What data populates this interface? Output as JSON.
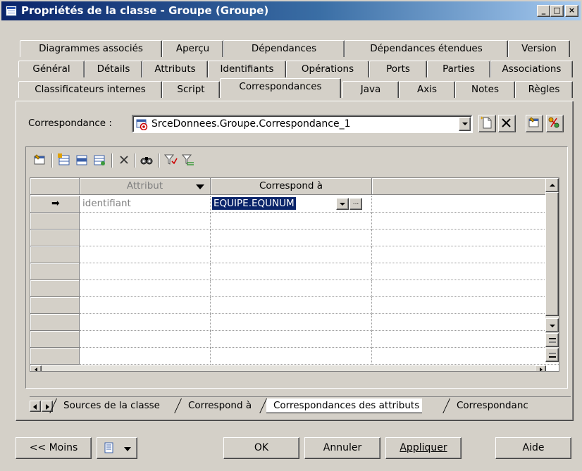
{
  "window": {
    "title": "Propriétés de la classe - Groupe (Groupe)",
    "controls": {
      "minimize": "_",
      "maximize": "□",
      "close": "×"
    }
  },
  "tabs": {
    "row1": [
      "Diagrammes associés",
      "Aperçu",
      "Dépendances",
      "Dépendances étendues",
      "Version"
    ],
    "row2": [
      "Général",
      "Détails",
      "Attributs",
      "Identifiants",
      "Opérations",
      "Ports",
      "Parties",
      "Associations"
    ],
    "row3": [
      "Classificateurs internes",
      "Script",
      "Correspondances",
      "Java",
      "Axis",
      "Notes",
      "Règles"
    ],
    "active": "Correspondances"
  },
  "mapping": {
    "label": "Correspondance :",
    "selected": "SrceDonnees.Groupe.Correspondance_1"
  },
  "grid": {
    "columns": [
      "Attribut",
      "Correspond à"
    ],
    "rows": [
      {
        "attribute": "identifiant",
        "maps_to": "EQUIPE.EQUNUM",
        "current": true
      }
    ],
    "ellipsis": "..."
  },
  "sheet_tabs": [
    "Sources de la classe",
    "Correspond à",
    "Correspondances des attributs",
    "Correspondanc"
  ],
  "active_sheet": "Correspondances des attributs",
  "buttons": {
    "less": "<< Moins",
    "ok": "OK",
    "cancel": "Annuler",
    "apply": "Appliquer",
    "help": "Aide"
  }
}
